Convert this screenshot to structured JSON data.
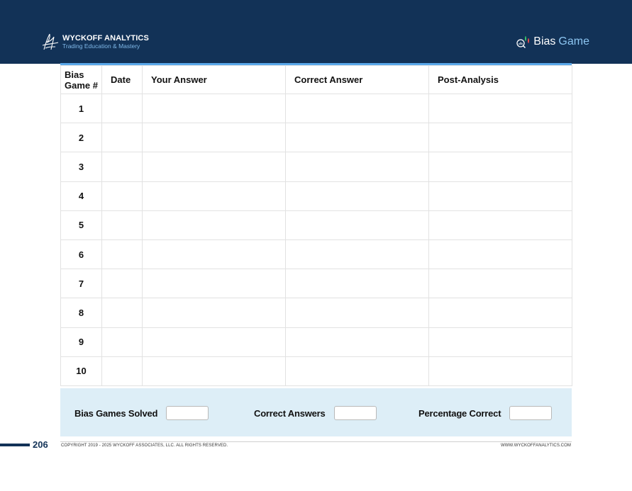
{
  "header": {
    "brand_name": "WYCKOFF ANALYTICS",
    "brand_tagline": "Trading Education & Mastery",
    "title_word1": "Bias",
    "title_word2": "Game"
  },
  "table": {
    "headers": [
      "Bias Game #",
      "Date",
      "Your Answer",
      "Correct Answer",
      "Post-Analysis"
    ],
    "rows": [
      "1",
      "2",
      "3",
      "4",
      "5",
      "6",
      "7",
      "8",
      "9",
      "10"
    ]
  },
  "summary": {
    "solved_label": "Bias Games Solved",
    "correct_label": "Correct Answers",
    "percent_label": "Percentage Correct"
  },
  "footer": {
    "page_number": "206",
    "copyright": "COPYRIGHT 2019 - 2025 WYCKOFF ASSOCIATES, LLC. ALL RIGHTS RESERVED.",
    "website": "WWW.WYCKOFFANALYTICS.COM"
  },
  "colors": {
    "header_bg": "#123257",
    "accent_blue": "#5aa8ea",
    "summary_bg": "#ddeef7"
  }
}
